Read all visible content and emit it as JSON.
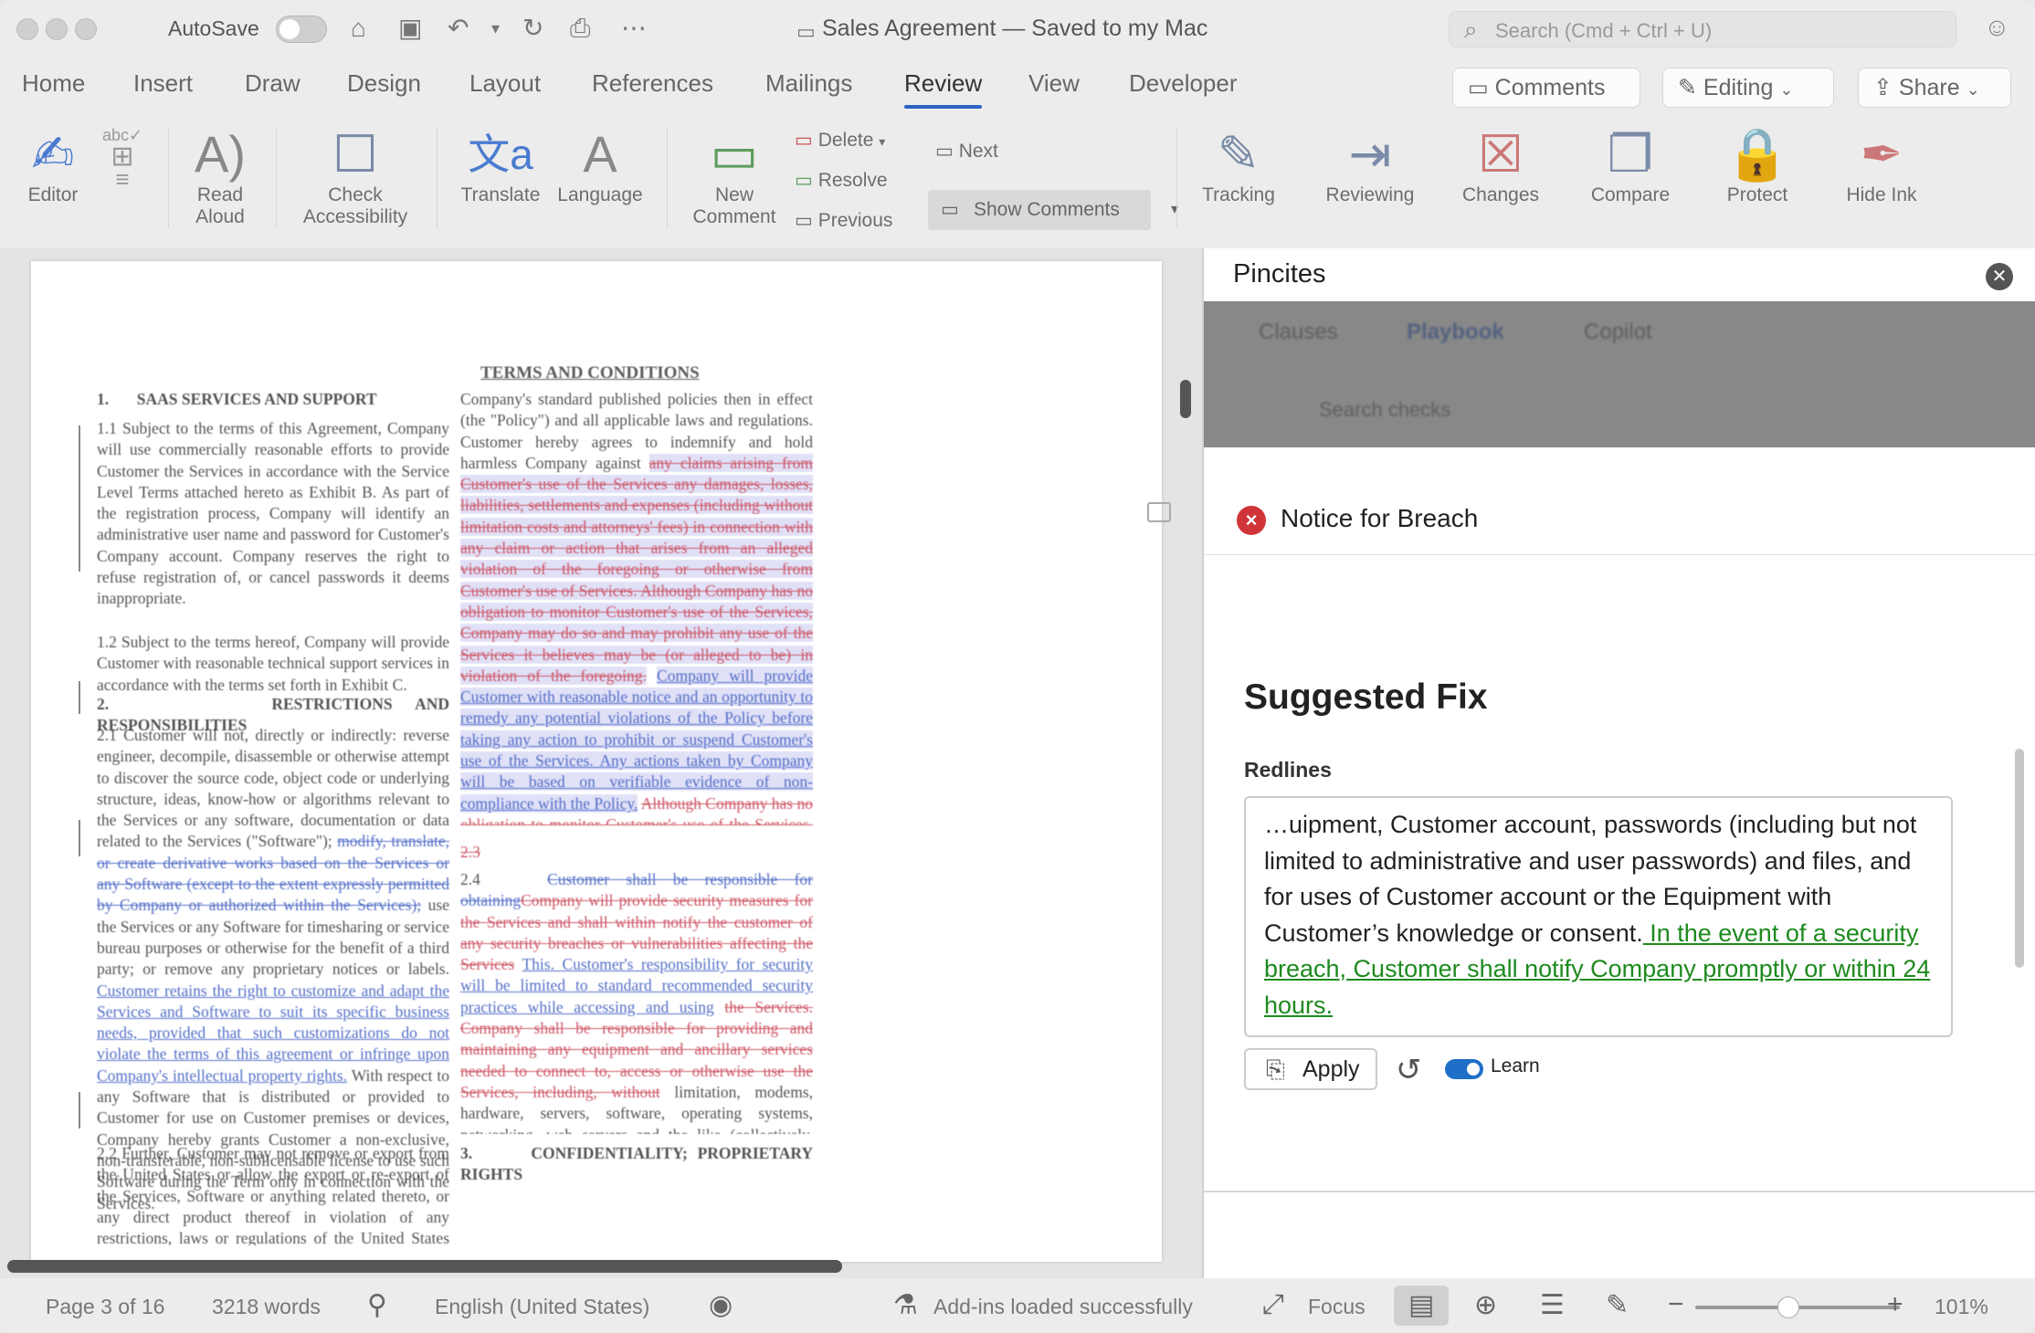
{
  "titlebar": {
    "autosave": "AutoSave",
    "doc_title": "Sales Agreement — Saved to my Mac",
    "search_placeholder": "Search (Cmd + Ctrl + U)"
  },
  "menu": {
    "tabs": [
      "Home",
      "Insert",
      "Draw",
      "Design",
      "Layout",
      "References",
      "Mailings",
      "Review",
      "View",
      "Developer"
    ],
    "active": "Review",
    "comments_button": "Comments",
    "editing_button": "Editing",
    "share_button": "Share"
  },
  "ribbon": {
    "editor": "Editor",
    "read_aloud": [
      "Read",
      "Aloud"
    ],
    "check_accessibility": [
      "Check",
      "Accessibility"
    ],
    "translate": "Translate",
    "language": "Language",
    "new_comment": [
      "New",
      "Comment"
    ],
    "delete": "Delete",
    "resolve": "Resolve",
    "previous": "Previous",
    "next": "Next",
    "show_comments": "Show Comments",
    "tracking": "Tracking",
    "reviewing": "Reviewing",
    "changes": "Changes",
    "compare": "Compare",
    "protect": "Protect",
    "hide_ink": "Hide Ink"
  },
  "document": {
    "heading": "TERMS AND CONDITIONS",
    "s1_num": "1.",
    "s1_title": "SAAS SERVICES AND SUPPORT",
    "p1_1": "1.1 Subject to the terms of this Agreement, Company will use commercially reasonable efforts to provide Customer the Services in accordance with the Service Level Terms attached hereto as Exhibit B. As part of the registration process, Company will identify an administrative user name and password for Customer's Company account. Company reserves the right to refuse registration of, or cancel passwords it deems inappropriate.",
    "p1_2": "1.2 Subject to the terms hereof, Company will provide Customer with reasonable technical support services in accordance with the terms set forth in Exhibit C.",
    "s2_num": "2.",
    "s2_title": "RESTRICTIONS AND RESPONSIBILITIES",
    "p2_1a": "2.1 Customer will not, directly or indirectly: reverse engineer, decompile, disassemble or otherwise attempt to discover the source code, object code or underlying structure, ideas, know-how or algorithms relevant to the Services or any software, documentation or data related to the Services (\"Software\");",
    "p2_1b_del": "modify, translate, or create derivative works based on the Services or any Software (except to the extent expressly permitted by Company or authorized within the Services);",
    "p2_1c": "use the Services or any Software for timesharing or service bureau purposes or otherwise for the benefit of a third party; or remove any proprietary notices or labels.",
    "p2_1d_ins": "Customer retains the right to customize and adapt the Services and Software to suit its specific business needs, provided that such customizations do not violate the terms of this agreement or infringe upon Company's intellectual property rights.",
    "p2_1e": "With respect to any Software that is distributed or provided to Customer for use on Customer premises or devices, Company hereby grants Customer a non-exclusive, non-transferable, non-sublicensable license to use such Software during the Term only in connection with the Services.",
    "p2_2": "2.2 Further, Customer may not remove or export from the United States or allow the export or re-export of the Services, Software or anything related thereto, or any direct product thereof in violation of any restrictions, laws or regulations of the United States Department of Commerce, the United States Department of",
    "r_p1": "Company's standard published policies then in effect (the \"Policy\") and all applicable laws and regulations. Customer hereby agrees to indemnify and hold harmless Company against",
    "r_p1_del": "any claims arising from Customer's use of the Services any damages, losses, liabilities, settlements and expenses (including without limitation costs and attorneys' fees) in connection with any claim or action that arises from an alleged violation of the foregoing or otherwise from Customer's use of Services. Although Company has no obligation to monitor Customer's use of the Services, Company may do so and may prohibit any use of the Services it believes may be (or alleged to be) in violation of the foregoing.",
    "r_p1_ins": "Company will provide Customer with reasonable notice and an opportunity to remedy any potential violations of the Policy before taking any action to prohibit or suspend Customer's use of the Services. Any actions taken by Company will be based on verifiable evidence of non-compliance with the Policy.",
    "r_p1_del2": "Although Company has no obligation to monitor Customer's use of the Services, Company may do so and may prohibit any use of the Services it believes may be (or alleged to be) in violation of the foregoing.",
    "r_23": "2.3",
    "r_24_num": "2.4",
    "r_24_del": "Customer shall be responsible for obtaining",
    "r_24_ins_red": "Company will provide security measures for the Services and shall within notify the customer of any security breaches or vulnerabilities affecting the Services",
    "r_24_ins_blue": "This. Customer's responsibility for security will be limited to standard recommended security practices while accessing and using",
    "r_24_del2": "the Services. Company shall be responsible for providing and maintaining any equipment and ancillary services needed to connect to, access or otherwise use the Services, including, without",
    "r_24_rest": "limitation, modems, hardware, servers, software, operating systems, networking, web servers and the like (collectively, \"Equipment\"). Customer shall also be responsible for maintaining the security of the Equipment, Customer account, passwords (including but not limited to administrative and user passwords) and files, and for all uses of Customer account or the Equipment with or without Customer's knowledge or consent.",
    "r_s3_num": "3.",
    "r_s3_title": "CONFIDENTIALITY; PROPRIETARY RIGHTS"
  },
  "pane": {
    "title": "Pincites",
    "tabs": [
      "Clauses",
      "Playbook",
      "Copilot"
    ],
    "search_placeholder": "Search checks",
    "notice_title": "Notice for Breach",
    "fix_title": "Suggested Fix",
    "redlines_label": "Redlines",
    "redline_text": "…uipment, Customer account, passwords (including but not limited to administrative and user passwords) and files, and for uses of Customer account or the Equipment with Customer’s knowledge or consent.",
    "redline_insert": " In the event of a security breach, Customer shall notify Company promptly or within 24 hours.",
    "apply": "Apply",
    "learn": "Learn",
    "learn_on": true
  },
  "status": {
    "page": "Page 3 of 16",
    "words": "3218 words",
    "language": "English (United States)",
    "addins": "Add-ins loaded successfully",
    "focus": "Focus",
    "zoom": "101%"
  },
  "colors": {
    "accent": "#2b64c5",
    "insert_green": "#1e8a1e",
    "error_red": "#d13438",
    "deletion_red": "#c0283c",
    "revision_blue": "#2346b8"
  }
}
